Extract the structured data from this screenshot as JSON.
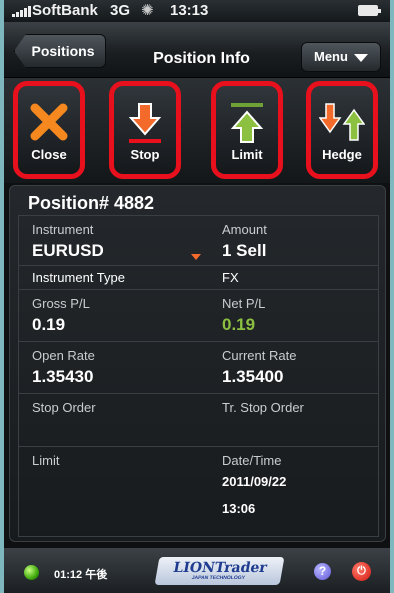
{
  "status_bar": {
    "carrier": "SoftBank",
    "network": "3G",
    "activity_icon": "spinner-icon",
    "time": "13:13"
  },
  "nav": {
    "back_label": "Positions",
    "title": "Position Info",
    "menu_label": "Menu"
  },
  "toolbar": {
    "buttons": [
      {
        "label": "Close",
        "icon": "close-x-icon"
      },
      {
        "label": "Stop",
        "icon": "arrow-down-icon"
      },
      {
        "label": "Limit",
        "icon": "arrow-up-icon"
      },
      {
        "label": "Hedge",
        "icon": "hedge-arrows-icon"
      }
    ]
  },
  "position": {
    "title": "Position# 4882",
    "instrument_label": "Instrument",
    "instrument": "EURUSD",
    "amount_label": "Amount",
    "amount": "1 Sell",
    "instrument_type_label": "Instrument Type",
    "instrument_type": "FX",
    "gross_pl_label": "Gross P/L",
    "gross_pl": "0.19",
    "net_pl_label": "Net P/L",
    "net_pl": "0.19",
    "open_rate_label": "Open Rate",
    "open_rate": "1.35430",
    "current_rate_label": "Current Rate",
    "current_rate": "1.35400",
    "stop_order_label": "Stop Order",
    "stop_order": "",
    "tr_stop_order_label": "Tr. Stop Order",
    "tr_stop_order": "",
    "limit_label": "Limit",
    "limit": "",
    "datetime_label": "Date/Time",
    "date": "2011/09/22",
    "time": "13:06"
  },
  "bottom_bar": {
    "clock": "01:12 午後",
    "logo_text": "LIONTrader",
    "logo_subtext": "JAPAN TECHNOLOGY"
  },
  "colors": {
    "highlight_red": "#e8101c",
    "positive_green": "#8cc040",
    "accent_orange": "#f36a2a"
  }
}
